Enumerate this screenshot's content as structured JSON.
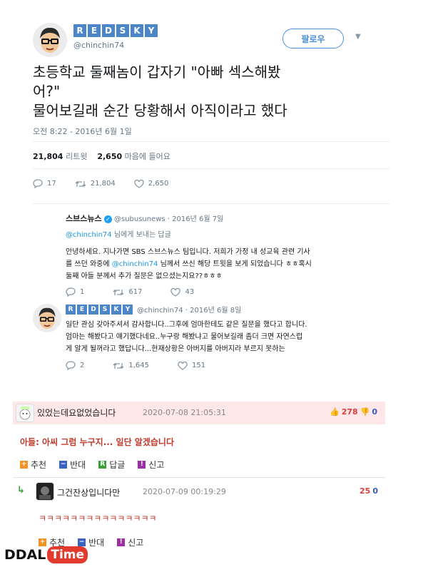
{
  "tweet": {
    "name_tiles": [
      "R",
      "E",
      "D",
      "S",
      "K",
      "Y"
    ],
    "handle": "@chinchin74",
    "follow_label": "팔로우",
    "text_line1": "초등학교 둘째놈이 갑자기 \"아빠 섹스해봤",
    "text_line2": "어?\"",
    "text_line3": "물어보길래 순간 당황해서 아직이라고 했다",
    "time": "오전 8:22 - 2016년 6월 1일",
    "retweet_count": "21,804",
    "retweet_label": "리트윗",
    "like_count": "2,650",
    "like_label": "마음에 들어요",
    "actions": {
      "reply": "17",
      "retweet": "21,804",
      "like": "2,650"
    }
  },
  "reply1": {
    "name": "스브스뉴스",
    "handle_date": "@subusunews · 2016년 6월 7일",
    "to_handle": "@chinchin74",
    "to_suffix": " 님에게 보내는 답글",
    "body_line1": "안녕하세요. 지나가면 SBS 스브스뉴스 팀입니다. 저희가 가정 내 성교육 관련 기사",
    "body_line2a": "를 쓰던 와중에 ",
    "body_line2b": "@chinchin74",
    "body_line2c": " 님께서 쓰신 해당 트윗을 보게 되었습니다 ㅎㅎ혹시",
    "body_line3": "둘째 아들 분께서 추가 질문은 없으셨는지요??ㅎㅎㅎ",
    "actions": {
      "reply": "1",
      "retweet": "617",
      "like": "43"
    }
  },
  "reply2": {
    "name_tiles": [
      "R",
      "E",
      "D",
      "S",
      "K",
      "Y"
    ],
    "handle_date": "@chinchin74 · 2016년 6월 8일",
    "body_line1": "일단 관심 갖아주셔서 감사합니다..그후에 엄마한테도 같은 질문을 했다고 합니다.",
    "body_line2": "엄마는 해봤다고 얘기했다네요..누구랑 해봤냐고 물어보길래 좀더 크면 자연스럽",
    "body_line3": "게 알게 될꺼라고 했답니다...현재상황은 아버지를 아버지라 부르지 못하는",
    "actions": {
      "reply": "2",
      "retweet": "1,645",
      "like": "151"
    }
  },
  "comment1": {
    "author": "있었는데요없었습니다",
    "date": "2020-07-08 21:05:31",
    "up": "278",
    "down": "0",
    "text": "아들: 아씨 그럼 누구지... 일단 알겠습니다",
    "buttons": {
      "recommend": "추천",
      "oppose": "반대",
      "reply": "답글",
      "report": "신고"
    }
  },
  "comment2": {
    "author": "그건잔상입니다만",
    "date": "2020-07-09 00:19:29",
    "up": "25",
    "down": "0",
    "text": "ㅋㅋㅋㅋㅋㅋㅋㅋㅋㅋㅋㅋㅋㅋㅋ",
    "buttons": {
      "recommend": "추천",
      "oppose": "반대",
      "report": "신고"
    }
  },
  "watermark": {
    "ddal": "DDAL",
    "time": "Time"
  },
  "colors": {
    "tile_blue": "#4a86c8",
    "link_blue": "#1b95e0",
    "comment_bg": "#fde7e9",
    "accent_red": "#e03e3e"
  }
}
